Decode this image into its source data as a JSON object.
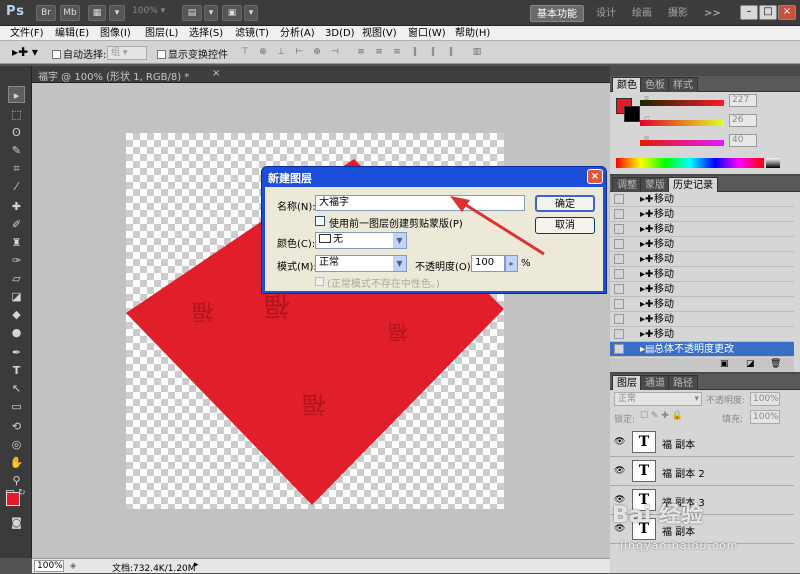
{
  "app": {
    "logo": "Ps",
    "zoom": "100%",
    "workspaces": [
      "基本功能",
      "设计",
      "绘画",
      "摄影"
    ],
    "more": ">>",
    "window_buttons": [
      "–",
      "□",
      "×"
    ]
  },
  "menu": [
    "文件(F)",
    "编辑(E)",
    "图像(I)",
    "图层(L)",
    "选择(S)",
    "滤镜(T)",
    "分析(A)",
    "3D(D)",
    "视图(V)",
    "窗口(W)",
    "帮助(H)"
  ],
  "options_bar": {
    "auto_select_label": "自动选择:",
    "auto_select_value": "组",
    "show_transform_label": "显示变换控件"
  },
  "document": {
    "tab_title": "福字 @ 100% (形状 1, RGB/8) *",
    "close": "×",
    "canvas_glyph": "福",
    "shape_color": "#e01f2b",
    "status_zoom": "100%",
    "status_doc": "文档:732.4K/1.20M"
  },
  "color_panel": {
    "tabs": [
      "颜色",
      "色板",
      "样式"
    ],
    "channels": [
      {
        "label": "R",
        "value": "227"
      },
      {
        "label": "G",
        "value": "26"
      },
      {
        "label": "B",
        "value": "40"
      }
    ],
    "foreground": "#e31a28"
  },
  "history_panel": {
    "tabs": [
      "调整",
      "蒙版",
      "历史记录"
    ],
    "items": [
      "移动",
      "移动",
      "移动",
      "移动",
      "移动",
      "移动",
      "移动",
      "移动",
      "移动",
      "移动"
    ],
    "selected": "总体不透明度更改"
  },
  "layers_panel": {
    "tabs": [
      "图层",
      "通道",
      "路径"
    ],
    "blend_mode": "正常",
    "opacity_label": "不透明度:",
    "opacity_value": "100%",
    "lock_label": "锁定:",
    "fill_label": "填充:",
    "fill_value": "100%",
    "layers": [
      {
        "thumb": "T",
        "name": "福 副本"
      },
      {
        "thumb": "T",
        "name": "福 副本 2"
      },
      {
        "thumb": "T",
        "name": "福 副本 3"
      },
      {
        "thumb": "T",
        "name": "福 副本"
      }
    ]
  },
  "dialog": {
    "title": "新建图层",
    "close": "×",
    "name_label": "名称(N):",
    "name_value": "大福字",
    "clip_label": "使用前一图层创建剪贴蒙版(P)",
    "color_label": "颜色(C):",
    "color_value": "无",
    "mode_label": "模式(M):",
    "mode_value": "正常",
    "opacity_label": "不透明度(O):",
    "opacity_value": "100",
    "opacity_unit": "%",
    "neutral_label": "(正常模式不存在中性色。)",
    "ok_label": "确定",
    "cancel_label": "取消",
    "arrow_color": "#e03030"
  },
  "watermark": {
    "text": "Bai 经验",
    "url": "jingyan.baidu.com"
  }
}
